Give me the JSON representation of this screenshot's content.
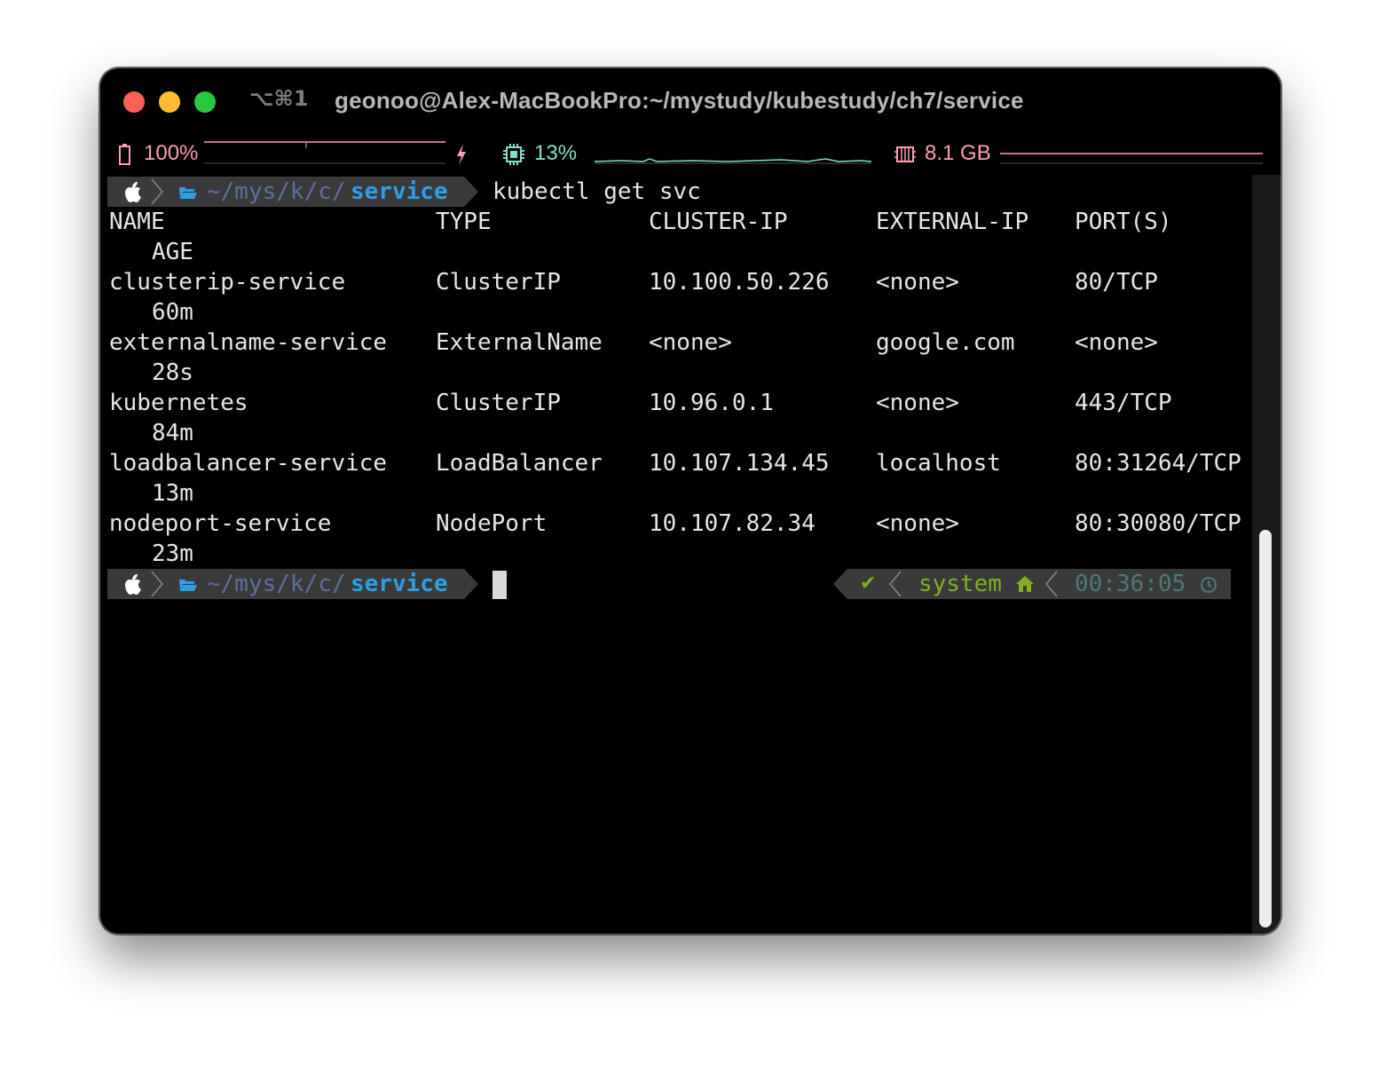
{
  "window": {
    "shortcut": "⌥⌘1",
    "title": "geonoo@Alex-MacBookPro:~/mystudy/kubestudy/ch7/service"
  },
  "status": {
    "battery": "100%",
    "cpu": "13%",
    "memory": "8.1 GB",
    "battery_color": "#ff9fb0",
    "cpu_color": "#7fe0c8",
    "memory_color": "#ff9fb0"
  },
  "prompt": {
    "path_prefix": "~/mys/k/c/",
    "path_dir": "service",
    "command": "kubectl get svc"
  },
  "table": {
    "headers": [
      "NAME",
      "TYPE",
      "CLUSTER-IP",
      "EXTERNAL-IP",
      "PORT(S)",
      "AGE"
    ],
    "rows": [
      [
        "clusterip-service",
        "ClusterIP",
        "10.100.50.226",
        "<none>",
        "80/TCP",
        "60m"
      ],
      [
        "externalname-service",
        "ExternalName",
        "<none>",
        "google.com",
        "<none>",
        "28s"
      ],
      [
        "kubernetes",
        "ClusterIP",
        "10.96.0.1",
        "<none>",
        "443/TCP",
        "84m"
      ],
      [
        "loadbalancer-service",
        "LoadBalancer",
        "10.107.134.45",
        "localhost",
        "80:31264/TCP",
        "13m"
      ],
      [
        "nodeport-service",
        "NodePort",
        "10.107.82.34",
        "<none>",
        "80:30080/TCP",
        "23m"
      ]
    ]
  },
  "right_prompt": {
    "status": "✔",
    "context": "system",
    "time": "00:36:05"
  },
  "colors": {
    "path_blue": "#2aa0e8",
    "path_dim": "#5c6fa0",
    "segment_bg": "#3a3a3a",
    "context_green": "#7fb020"
  }
}
